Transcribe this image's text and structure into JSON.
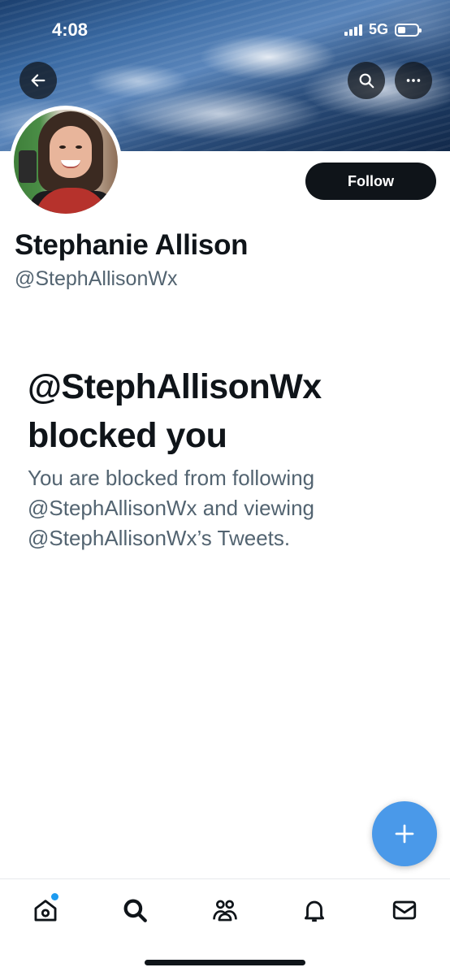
{
  "status_bar": {
    "time": "4:08",
    "network": "5G"
  },
  "header": {
    "back_icon": "arrow-left-icon",
    "search_icon": "search-icon",
    "more_icon": "more-horizontal-icon"
  },
  "profile": {
    "display_name": "Stephanie Allison",
    "handle": "@StephAllisonWx",
    "follow_label": "Follow"
  },
  "blocked": {
    "title": "@StephAllisonWx blocked you",
    "description": "You are blocked from following @StephAllisonWx and viewing @StephAllisonWx’s Tweets."
  },
  "fab": {
    "icon": "plus-icon"
  },
  "tabbar": {
    "items": [
      {
        "icon": "home-icon",
        "has_notification_dot": true
      },
      {
        "icon": "search-icon"
      },
      {
        "icon": "communities-icon"
      },
      {
        "icon": "bell-icon"
      },
      {
        "icon": "mail-icon"
      }
    ]
  },
  "colors": {
    "follow_bg": "#0f1419",
    "secondary_text": "#536471",
    "fab_bg": "#4a99e9",
    "notification_dot": "#1d9bf0"
  }
}
